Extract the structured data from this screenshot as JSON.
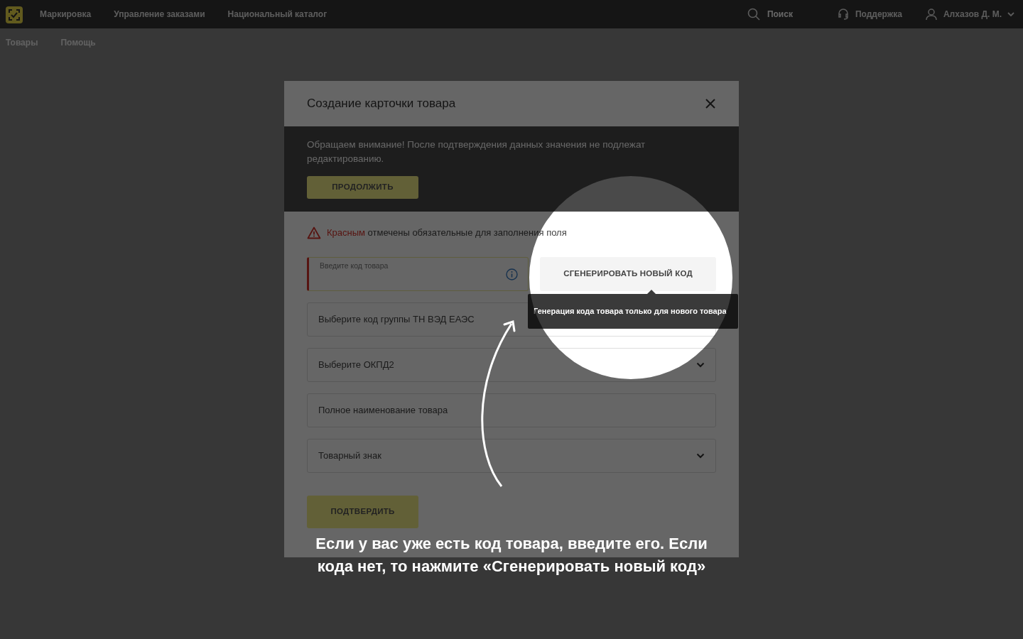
{
  "topbar": {
    "nav": [
      {
        "label": "Маркировка"
      },
      {
        "label": "Управление заказами"
      },
      {
        "label": "Национальный каталог"
      }
    ],
    "search": {
      "placeholder": "Поиск"
    },
    "support": "Поддержка",
    "user": "Алхазов Д. М."
  },
  "subnav": [
    {
      "label": "Товары"
    },
    {
      "label": "Помощь"
    }
  ],
  "modal": {
    "title": "Создание карточки товара",
    "notice": "Обращаем внимание! После подтверждения данных значения не подлежат редактированию.",
    "notice_button": "ПРОДОЛЖИТЬ",
    "required_note": {
      "highlight": "Красным",
      "text": "отмечены обязательные для заполнения поля"
    },
    "code_field": {
      "label": "Введите код товара",
      "required": true
    },
    "generate_button": "СГЕНЕРИРОВАТЬ НОВЫЙ КОД",
    "tooltip": "Генерация кода товара только для нового товара",
    "fields": [
      {
        "kind": "select",
        "placeholder": "Выберите код группы ТН ВЭД ЕАЭС"
      },
      {
        "kind": "select",
        "placeholder": "Выберите ОКПД2"
      },
      {
        "kind": "text",
        "placeholder": "Полное наименование товара"
      },
      {
        "kind": "select",
        "placeholder": "Товарный знак"
      }
    ],
    "confirm_button": "ПОДТВЕРДИТЬ"
  },
  "tutorial": {
    "caption": "Если у вас уже есть код товара, введите его. Если кода нет, то нажмите «Сгенерировать новый код»"
  }
}
